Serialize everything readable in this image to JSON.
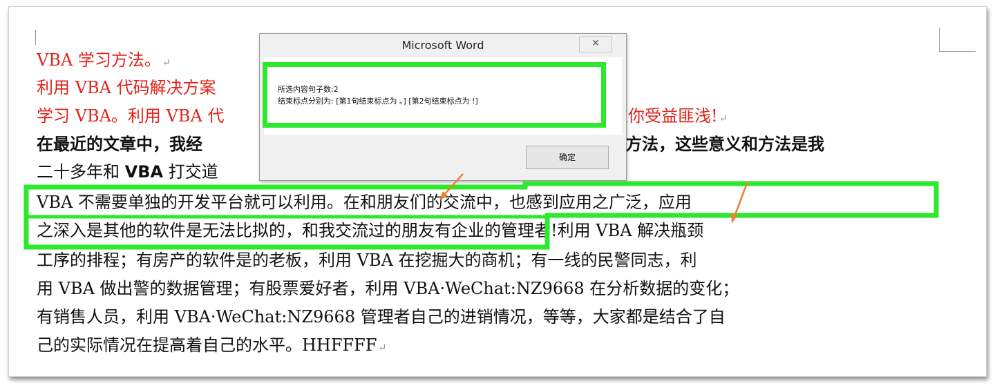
{
  "document": {
    "lines": [
      {
        "text": "VBA 学习方法。"
      },
      {
        "text": "利用 VBA 代码解决方案"
      },
      {
        "text_left": "学习 VBA。利用 VBA 代",
        "text_right": "让你受益匪浅!"
      },
      {
        "text_left": "在最近的文章中，我经",
        "text_right": "的方法，这些意义和方法是我"
      },
      {
        "text_a": "二十多年和 ",
        "text_b": "VBA",
        "text_c": " 打交道"
      },
      {
        "text": "VBA 不需要单独的开发平台就可以利用。在和朋友们的交流中，也感到应用之广泛，应用"
      },
      {
        "text": "之深入是其他的软件是无法比拟的，和我交流过的朋友有企业的管理者!利用 VBA 解决瓶颈"
      },
      {
        "text": "工序的排程；有房产的软件是的老板，利用 VBA 在挖掘大的商机；有一线的民警同志，利"
      },
      {
        "text": "用 VBA 做出警的数据管理；有股票爱好者，利用 VBA·WeChat:NZ9668 在分析数据的变化；"
      },
      {
        "text": "有销售人员，利用 VBA·WeChat:NZ9668 管理者自己的进销情况，等等，大家都是结合了自"
      },
      {
        "text": "己的实际情况在提高着自己的水平。HHFFFF"
      }
    ],
    "paragraph_mark": "↵"
  },
  "dialog": {
    "title": "Microsoft Word",
    "close_label": "✕",
    "message_line1": "所选内容句子数:2",
    "message_line2": "结束标点分别为: [第1句结束标点为 。] [第2句结束标点为 !]",
    "ok_label": "确定"
  },
  "annotations": {
    "highlight_color": "#2ee82e",
    "arrow_color": "#f07f2e"
  }
}
